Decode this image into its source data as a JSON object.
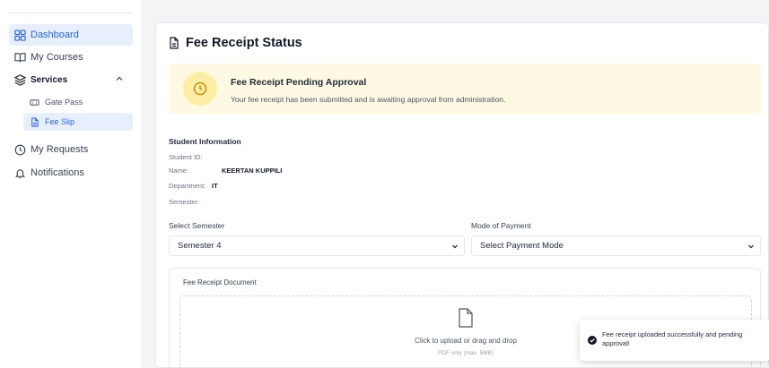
{
  "sidebar": {
    "items": [
      {
        "label": "Dashboard",
        "icon": "dashboard-grid-icon",
        "active": true
      },
      {
        "label": "My Courses",
        "icon": "book-open-icon"
      },
      {
        "label": "Services",
        "icon": "layers-icon",
        "expanded": true
      },
      {
        "label": "My Requests",
        "icon": "clock-icon"
      },
      {
        "label": "Notifications",
        "icon": "bell-icon"
      }
    ],
    "subitems": [
      {
        "label": "Gate Pass",
        "icon": "ticket-icon"
      },
      {
        "label": "Fee Slip",
        "icon": "document-icon",
        "active": true
      }
    ]
  },
  "main": {
    "card_title": "Fee Receipt Status",
    "alert": {
      "title": "Fee Receipt Pending Approval",
      "text": "Your fee receipt has been submitted and is awaiting approval from administration."
    },
    "student_info": {
      "heading": "Student Information",
      "rows": [
        {
          "label": "Student ID:",
          "value": ""
        },
        {
          "label": "Name:",
          "value": "KEERTAN KUPPILI"
        },
        {
          "label": "Department:",
          "value": "IT"
        },
        {
          "label": "Semester:",
          "value": ""
        }
      ]
    },
    "semester": {
      "label": "Select Semester",
      "value": "Semester 4"
    },
    "payment": {
      "label": "Mode of Payment",
      "value": "Select Payment Mode"
    },
    "document": {
      "label": "Fee Receipt Document",
      "drop_text": "Click to upload or drag and drop",
      "drop_hint": "PDF only (max. 5MB)"
    }
  },
  "toast": {
    "message": "Fee receipt uploaded successfully and pending approval!"
  },
  "colors": {
    "accent": "#2563eb",
    "alert_bg": "#fef9e3",
    "alert_icon_bg": "#fdeea6",
    "alert_icon": "#ca8a04"
  }
}
